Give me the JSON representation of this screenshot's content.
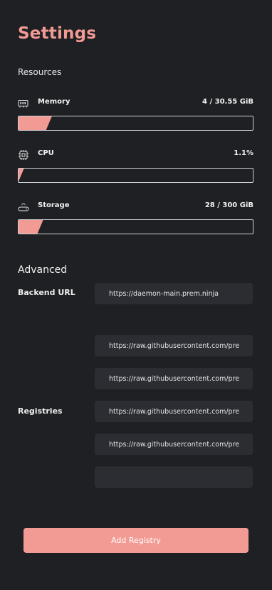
{
  "page": {
    "title": "Settings"
  },
  "resources": {
    "heading": "Resources",
    "items": [
      {
        "name": "Memory",
        "value": "4 / 30.55 GiB",
        "fill_fraction": 0.13,
        "icon": "memory-icon"
      },
      {
        "name": "CPU",
        "value": "1.1%",
        "fill_fraction": 0.011,
        "icon": "cpu-icon"
      },
      {
        "name": "Storage",
        "value": "28 / 300 GiB",
        "fill_fraction": 0.093,
        "icon": "storage-icon"
      }
    ]
  },
  "advanced": {
    "heading": "Advanced",
    "backend_url_label": "Backend URL",
    "backend_url_value": "https://daemon-main.prem.ninja",
    "registries_label": "Registries",
    "registries": [
      "https://raw.githubusercontent.com/premAI-io/prem-registry/main/manifests.json",
      "https://raw.githubusercontent.com/premAI-io/prem-registry/dev/manifests.json",
      "https://raw.githubusercontent.com/premAI-io/prem-registry/main/manifests.json",
      "https://raw.githubusercontent.com/premAI-io/prem-registry/main/manifests.json",
      ""
    ],
    "add_registry_label": "Add Registry"
  },
  "colors": {
    "accent": "#f29b94",
    "background": "#1f2024",
    "input_background": "#2c2d33",
    "bar_border": "#cfcfd2"
  }
}
